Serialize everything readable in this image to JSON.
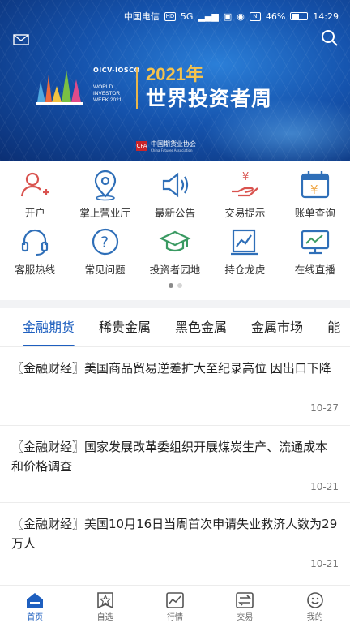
{
  "status_bar": {
    "carrier": "中国电信",
    "network_1": "HD",
    "network_2": "5G",
    "nfc": "N",
    "battery": "46%",
    "time": "14:29"
  },
  "banner": {
    "org_logo_text": "OICV-IOSCO",
    "event_en_1": "WORLD",
    "event_en_2": "INVESTOR",
    "event_en_3": "WEEK 2021",
    "year_title": "2021年",
    "event_title": "世界投资者周",
    "association": "中国期货业协会",
    "association_en": "China Futures Association",
    "association_mark": "CFA"
  },
  "menu": {
    "items": [
      {
        "label": "开户",
        "icon": "user-add-icon"
      },
      {
        "label": "掌上营业厅",
        "icon": "location-pin-icon"
      },
      {
        "label": "最新公告",
        "icon": "speaker-icon"
      },
      {
        "label": "交易提示",
        "icon": "hand-coin-icon"
      },
      {
        "label": "账单查询",
        "icon": "calendar-bill-icon"
      },
      {
        "label": "客服热线",
        "icon": "headset-icon"
      },
      {
        "label": "常见问题",
        "icon": "question-icon"
      },
      {
        "label": "投资者园地",
        "icon": "graduation-cap-icon"
      },
      {
        "label": "持仓龙虎",
        "icon": "chart-board-icon"
      },
      {
        "label": "在线直播",
        "icon": "monitor-icon"
      }
    ],
    "page_count": 2,
    "active_page": 1
  },
  "tabs": [
    {
      "label": "金融期货",
      "active": true
    },
    {
      "label": "稀贵金属",
      "active": false
    },
    {
      "label": "黑色金属",
      "active": false
    },
    {
      "label": "金属市场",
      "active": false
    },
    {
      "label": "能",
      "active": false
    }
  ],
  "news": [
    {
      "title": "〖金融财经〗美国商品贸易逆差扩大至纪录高位 因出口下降",
      "date": "10-27"
    },
    {
      "title": "〖金融财经〗国家发展改革委组织开展煤炭生产、流通成本和价格调查",
      "date": "10-21"
    },
    {
      "title": "〖金融财经〗美国10月16日当周首次申请失业救济人数为29万人",
      "date": "10-21"
    }
  ],
  "bottom_nav": [
    {
      "label": "首页",
      "icon": "home-icon",
      "active": true
    },
    {
      "label": "自选",
      "icon": "star-icon",
      "active": false
    },
    {
      "label": "行情",
      "icon": "trend-chart-icon",
      "active": false
    },
    {
      "label": "交易",
      "icon": "exchange-icon",
      "active": false
    },
    {
      "label": "我的",
      "icon": "smile-icon",
      "active": false
    }
  ],
  "colors": {
    "accent": "#1e5fbf",
    "icon_red": "#d9534f",
    "icon_blue": "#2f6fb8",
    "icon_green": "#3a9a62",
    "banner_gold": "#f4c24d"
  }
}
